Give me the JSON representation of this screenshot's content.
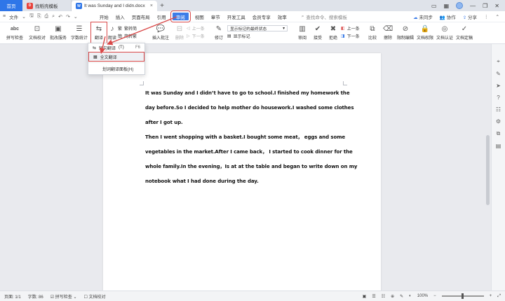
{
  "titlebar": {
    "home_tab": "首页",
    "tabs": [
      {
        "label": "找稻壳模板",
        "icon": "docer-icon",
        "color": "#e8423b",
        "active": false
      },
      {
        "label": "It was Sunday and I didn.docx",
        "icon": "word-doc-icon",
        "color": "#2f76e8",
        "active": true
      }
    ]
  },
  "menubar": {
    "file_label": "文件",
    "tabs": [
      "开始",
      "插入",
      "页面布局",
      "引用",
      "审阅",
      "视图",
      "章节",
      "开发工具",
      "会员专享",
      "效率"
    ],
    "selected_tab": "审阅",
    "search_placeholder": "查找命令、搜索模板",
    "right": {
      "sync": "未同步",
      "collab": "协作",
      "share": "分享"
    }
  },
  "ribbon": {
    "spell_check": "拼写检查",
    "doc_compare": "文档校对",
    "batch_service": "批改服务",
    "word_count": "字数统计",
    "translate": "翻译",
    "translate_sub": "朗读",
    "simp_trad": "繁转简",
    "trad_simp": "简转繁",
    "insert_comment": "插入批注",
    "delete": "删除",
    "prev": "上一条",
    "next": "下一条",
    "revise": "修订",
    "display_state": "显示标记的最终状态",
    "show_markup": "显示标记",
    "review": "审阅",
    "accept": "接受",
    "reject": "拒绝",
    "prev2": "上一条",
    "next2": "下一条",
    "compare": "比较",
    "erase": "擦除",
    "restrict_edit": "限制编辑",
    "doc_permission": "文档权限",
    "doc_cert": "文档认证",
    "doc_finalize": "文档定稿"
  },
  "dropdown": {
    "items": [
      {
        "label": "短句翻译",
        "key": "(T)",
        "shortcut": "F6",
        "highlighted": false
      },
      {
        "label": "全文翻译",
        "key": "",
        "shortcut": "",
        "highlighted": true
      },
      {
        "label": "划词翻译面板(H)",
        "key": "",
        "shortcut": "",
        "highlighted": false
      }
    ]
  },
  "document": {
    "lines": [
      "It was Sunday and I didn’t have to go to school.I finished my homework the",
      "day before.So I decided to help mother do housework.I washed some clothes",
      "after I got up.",
      "Then I went shopping with a basket.I bought some meat， eggs and some",
      "vegetables in the market.After I came back， I started to cook dinner for the",
      "whole family.In the evening，Is at at the table and began to write down on my",
      "notebook what I had done during the day."
    ]
  },
  "statusbar": {
    "page": "页面: 1/1",
    "words": "字数: 86",
    "spell": "拼写检查",
    "proof": "文档校对",
    "zoom": "100%"
  },
  "colors": {
    "accent": "#3d7de8",
    "highlight_box": "#d94848",
    "home_tab": "#2f76e8"
  }
}
